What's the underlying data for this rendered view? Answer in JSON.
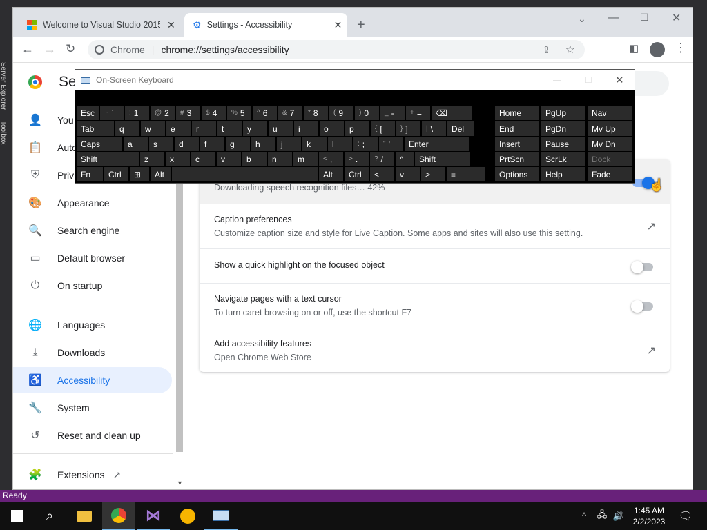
{
  "vs": {
    "status": "Ready",
    "sidebar_labels": [
      "Server Explorer",
      "Toolbox"
    ]
  },
  "chrome": {
    "tabs": [
      {
        "title": "Welcome to Visual Studio 2015 |"
      },
      {
        "title": "Settings - Accessibility"
      }
    ],
    "omnibox": {
      "site": "Chrome",
      "url": "chrome://settings/accessibility"
    },
    "header_title": "Se"
  },
  "sidenav": {
    "items": [
      {
        "label": "You and Google",
        "icon": "person-icon"
      },
      {
        "label": "Autofill",
        "icon": "clipboard-icon"
      },
      {
        "label": "Privacy and security",
        "icon": "shield-icon"
      },
      {
        "label": "Appearance",
        "icon": "palette-icon"
      },
      {
        "label": "Search engine",
        "icon": "search-icon"
      },
      {
        "label": "Default browser",
        "icon": "browser-icon"
      },
      {
        "label": "On startup",
        "icon": "power-icon"
      },
      {
        "label": "Languages",
        "icon": "globe-icon"
      },
      {
        "label": "Downloads",
        "icon": "download-icon"
      },
      {
        "label": "Accessibility",
        "icon": "accessibility-icon"
      },
      {
        "label": "System",
        "icon": "wrench-icon"
      },
      {
        "label": "Reset and clean up",
        "icon": "history-icon"
      },
      {
        "label": "Extensions",
        "icon": "puzzle-icon"
      }
    ],
    "truncated": [
      "You",
      "Auto",
      "Priv"
    ]
  },
  "content": {
    "live_caption_status": "Downloading speech recognition files… 42%",
    "live_caption_progress_percent": 42,
    "rows": [
      {
        "title": "Caption preferences",
        "subtitle": "Customize caption size and style for Live Caption. Some apps and sites will also use this setting."
      },
      {
        "title": "Show a quick highlight on the focused object",
        "subtitle": ""
      },
      {
        "title": "Navigate pages with a text cursor",
        "subtitle": "To turn caret browsing on or off, use the shortcut F7"
      },
      {
        "title": "Add accessibility features",
        "subtitle": "Open Chrome Web Store"
      }
    ]
  },
  "osk": {
    "title": "On-Screen Keyboard",
    "rows": [
      [
        "Esc",
        "~ `",
        "! 1",
        "@ 2",
        "# 3",
        "$ 4",
        "% 5",
        "^ 6",
        "& 7",
        "* 8",
        "( 9",
        ") 0",
        "_ -",
        "+ =",
        "⌫"
      ],
      [
        "Tab",
        "q",
        "w",
        "e",
        "r",
        "t",
        "y",
        "u",
        "i",
        "o",
        "p",
        "{ [",
        "} ]",
        "| \\",
        "Del"
      ],
      [
        "Caps",
        "a",
        "s",
        "d",
        "f",
        "g",
        "h",
        "j",
        "k",
        "l",
        ": ;",
        "\" '",
        "Enter"
      ],
      [
        "Shift",
        "z",
        "x",
        "c",
        "v",
        "b",
        "n",
        "m",
        "< ,",
        "> .",
        "? /",
        "^",
        "Shift"
      ],
      [
        "Fn",
        "Ctrl",
        "⊞",
        "Alt",
        "",
        "Alt",
        "Ctrl",
        "<",
        "v",
        ">",
        "≡"
      ]
    ],
    "right": [
      [
        "Home",
        "PgUp",
        "Nav"
      ],
      [
        "End",
        "PgDn",
        "Mv Up"
      ],
      [
        "Insert",
        "Pause",
        "Mv Dn"
      ],
      [
        "PrtScn",
        "ScrLk",
        "Dock"
      ],
      [
        "Options",
        "Help",
        "Fade"
      ]
    ]
  },
  "taskbar": {
    "time": "1:45 AM",
    "date": "2/2/2023"
  }
}
